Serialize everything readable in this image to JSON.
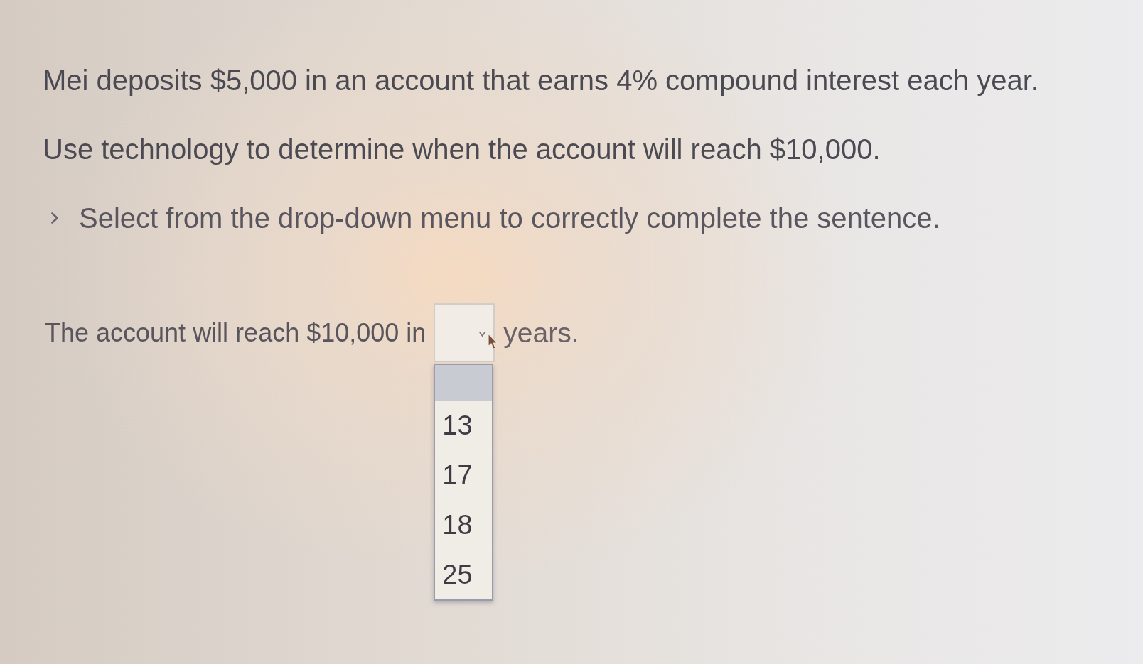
{
  "question": {
    "paragraphs": [
      "Mei deposits $5,000 in an account that earns 4% compound interest each year.",
      "Use technology to determine when the account will reach $10,000."
    ]
  },
  "instruction": {
    "text": "Select from the drop-down menu to correctly complete the sentence."
  },
  "answer_sentence": {
    "text_before": "The account will reach $10,000 in",
    "dropdown": {
      "expanded": true,
      "options": [
        {
          "kind": "blank",
          "selected": true
        },
        {
          "kind": "value",
          "label": "13",
          "selected": false
        },
        {
          "kind": "value",
          "label": "17",
          "selected": false
        },
        {
          "kind": "value",
          "label": "18",
          "selected": false
        },
        {
          "kind": "value",
          "label": "25",
          "selected": false
        }
      ]
    },
    "text_after": "years."
  }
}
